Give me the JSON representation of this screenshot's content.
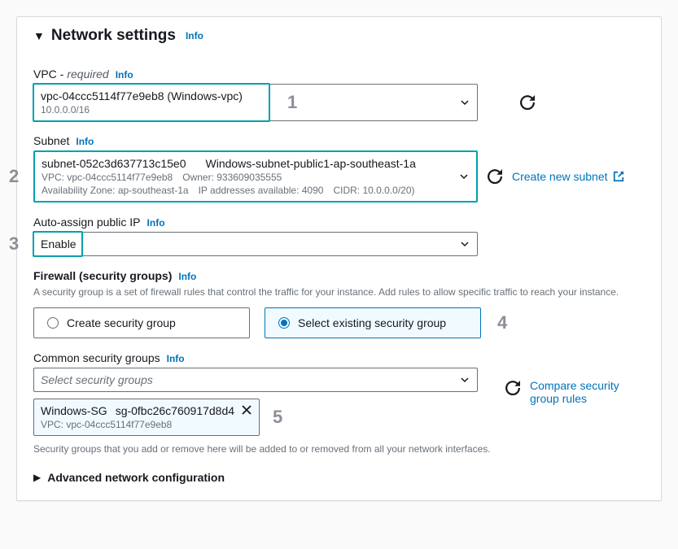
{
  "header": {
    "title": "Network settings",
    "info": "Info"
  },
  "vpc": {
    "label": "VPC -",
    "required": "required",
    "info": "Info",
    "selected_name": "vpc-04ccc5114f77e9eb8 (Windows-vpc)",
    "selected_cidr": "10.0.0.0/16"
  },
  "subnet": {
    "label": "Subnet",
    "info": "Info",
    "selected_id": "subnet-052c3d637713c15e0",
    "selected_name": "Windows-subnet-public1-ap-southeast-1a",
    "detail_vpc": "VPC: vpc-04ccc5114f77e9eb8",
    "detail_owner": "Owner: 933609035555",
    "detail_az": "Availability Zone: ap-southeast-1a",
    "detail_ips": "IP addresses available: 4090",
    "detail_cidr": "CIDR: 10.0.0.0/20)",
    "create_link": "Create new subnet"
  },
  "auto_ip": {
    "label": "Auto-assign public IP",
    "info": "Info",
    "value": "Enable"
  },
  "firewall": {
    "label": "Firewall (security groups)",
    "info": "Info",
    "help": "A security group is a set of firewall rules that control the traffic for your instance. Add rules to allow specific traffic to reach your instance.",
    "option_create": "Create security group",
    "option_existing": "Select existing security group"
  },
  "common_sg": {
    "label": "Common security groups",
    "info": "Info",
    "placeholder": "Select security groups",
    "compare_link": "Compare security group rules",
    "chip_name": "Windows-SG",
    "chip_id": "sg-0fbc26c760917d8d4",
    "chip_vpc": "VPC: vpc-04ccc5114f77e9eb8",
    "help": "Security groups that you add or remove here will be added to or removed from all your network interfaces."
  },
  "advanced": {
    "label": "Advanced network configuration"
  },
  "callouts": {
    "n1": "1",
    "n2": "2",
    "n3": "3",
    "n4": "4",
    "n5": "5"
  }
}
